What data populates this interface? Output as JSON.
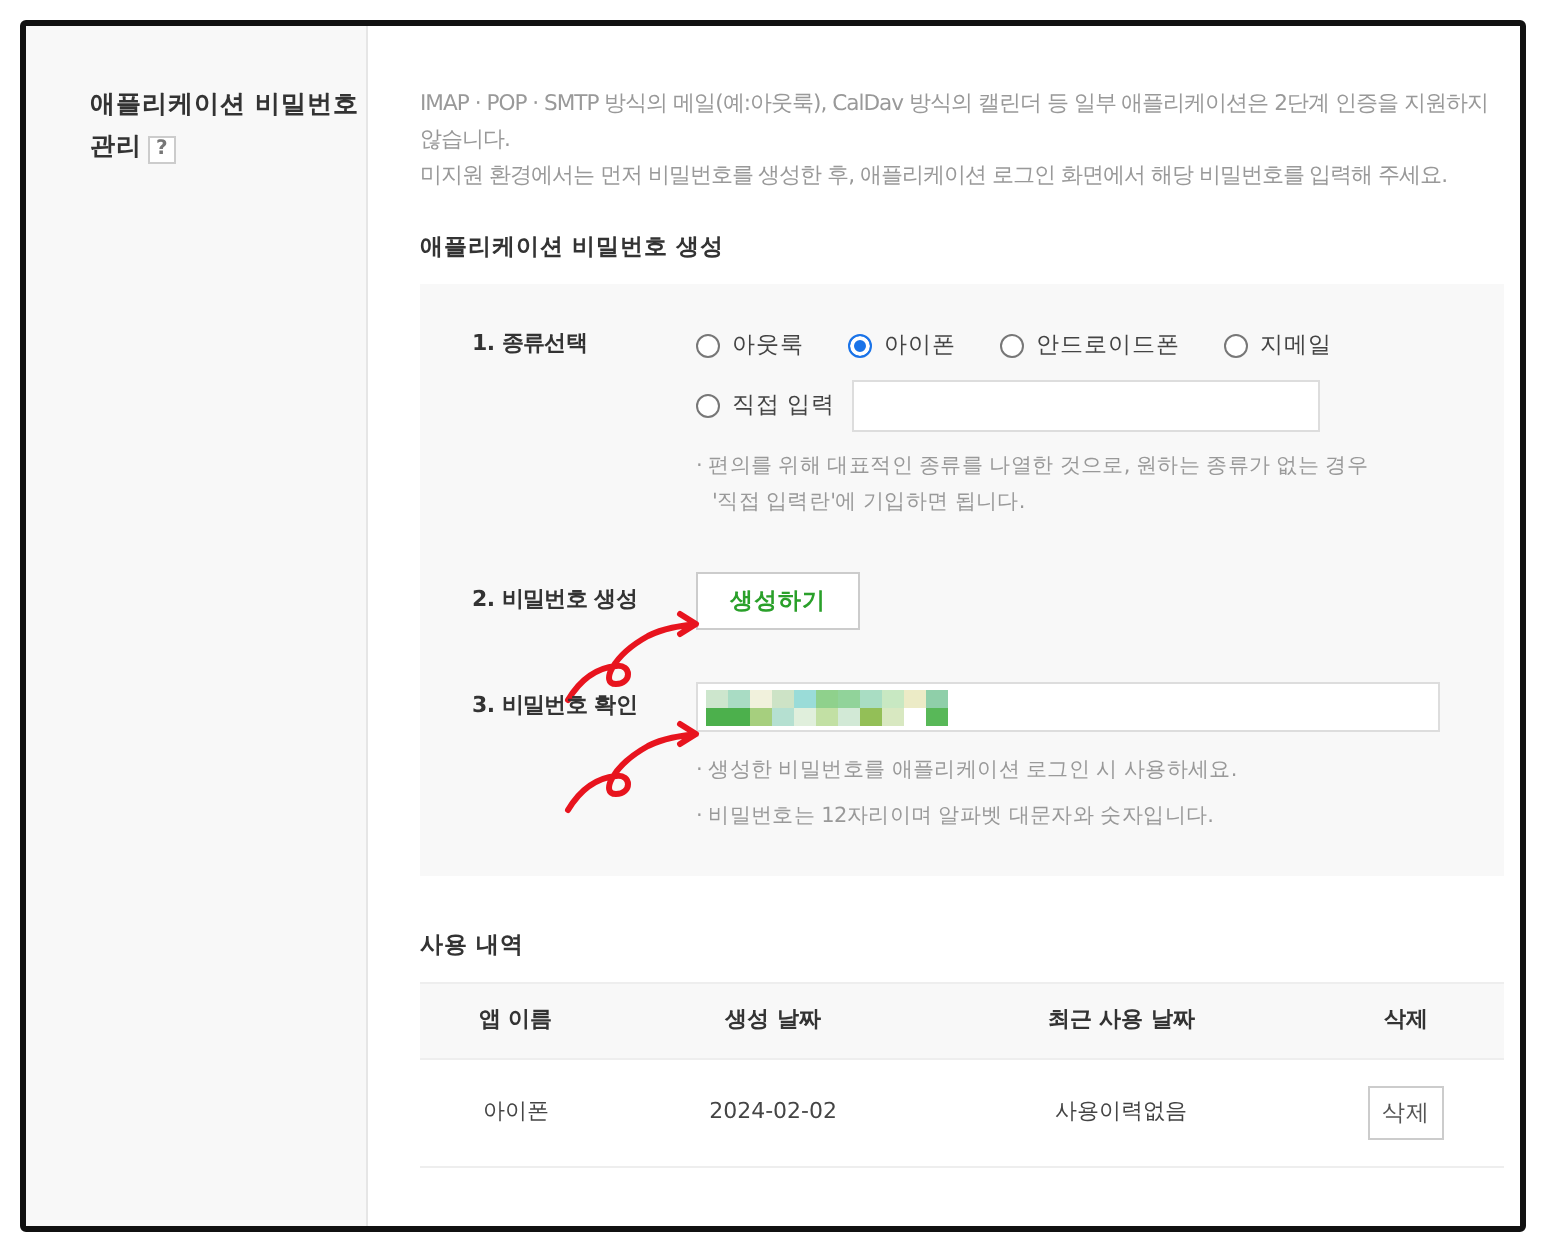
{
  "section": {
    "title_lines": [
      "애플리케이션 비밀번호",
      "관리"
    ],
    "help": "?"
  },
  "description": [
    "IMAP · POP · SMTP 방식의 메일(예:아웃룩), CalDav 방식의 캘린더 등 일부 애플리케이션은 2단계 인증을 지원하지 않습니다.",
    "미지원 환경에서는 먼저 비밀번호를 생성한 후, 애플리케이션 로그인 화면에서 해당 비밀번호를 입력해 주세요."
  ],
  "generate": {
    "heading": "애플리케이션 비밀번호 생성",
    "type_step": {
      "label": "1. 종류선택",
      "options": [
        {
          "label": "아웃룩",
          "selected": false
        },
        {
          "label": "아이폰",
          "selected": true
        },
        {
          "label": "안드로이드폰",
          "selected": false
        },
        {
          "label": "지메일",
          "selected": false
        }
      ],
      "custom": {
        "label": "직접 입력",
        "selected": false
      },
      "note": "· 편의를 위해 대표적인 종류를 나열한 것으로, 원하는 종류가 없는 경우 '직접 입력란'에 기입하면 됩니다."
    },
    "create_step": {
      "label": "2. 비밀번호 생성",
      "button": "생성하기"
    },
    "confirm_step": {
      "label": "3. 비밀번호 확인",
      "hints": [
        "· 생성한 비밀번호를 애플리케이션 로그인 시 사용하세요.",
        "· 비밀번호는 12자리이며 알파벳 대문자와 숫자입니다."
      ]
    }
  },
  "history": {
    "heading": "사용 내역",
    "columns": [
      "앱 이름",
      "생성 날짜",
      "최근 사용 날짜",
      "삭제"
    ],
    "rows": [
      {
        "app": "아이폰",
        "created": "2024-02-02",
        "last_used": "사용이력없음",
        "action": "삭제"
      }
    ]
  }
}
